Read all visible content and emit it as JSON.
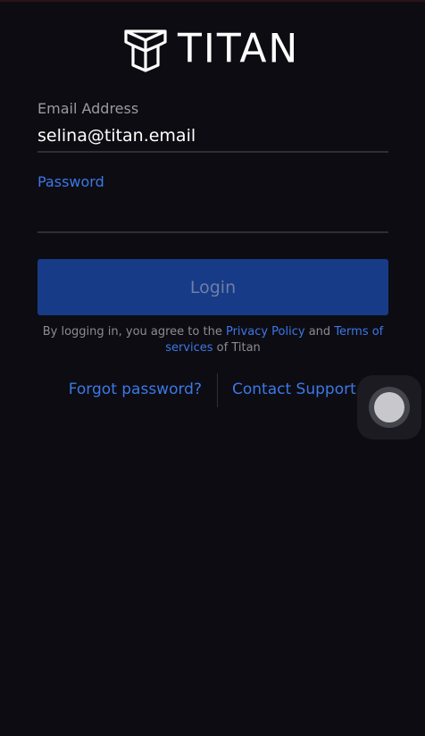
{
  "brand": {
    "logo_icon": "titan-logo-icon",
    "name": "TITAN"
  },
  "form": {
    "email": {
      "label": "Email Address",
      "value": "selina@titan.email"
    },
    "password": {
      "label": "Password",
      "value": ""
    },
    "login_button": "Login"
  },
  "legal": {
    "prefix": "By logging in, you agree to the ",
    "privacy_link": "Privacy Policy",
    "middle": " and ",
    "terms_link": "Terms of services",
    "suffix": " of Titan"
  },
  "links": {
    "forgot_password": "Forgot password?",
    "contact_support": "Contact Support"
  },
  "colors": {
    "background": "#0d0c12",
    "accent": "#3b78e7",
    "button": "#173b86",
    "muted_text": "#9a9aa3"
  },
  "overlay": {
    "icon": "assistive-touch-icon"
  }
}
